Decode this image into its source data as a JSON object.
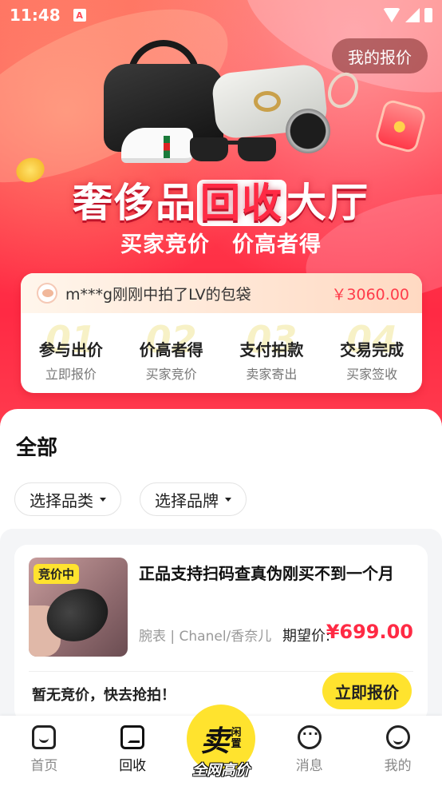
{
  "status_bar": {
    "time": "11:48",
    "notification_badge": "A"
  },
  "header": {
    "my_quotes_label": "我的报价"
  },
  "hero": {
    "title_part1": "奢侈品",
    "title_highlight": "回收",
    "title_part2": "大厅",
    "subtitle": "买家竞价　价高者得"
  },
  "ticker": {
    "text": "m***g刚刚中拍了LV的包袋",
    "price": "￥3060.00"
  },
  "steps": [
    {
      "num": "01",
      "title": "参与出价",
      "sub": "立即报价"
    },
    {
      "num": "02",
      "title": "价高者得",
      "sub": "买家竞价"
    },
    {
      "num": "03",
      "title": "支付拍款",
      "sub": "卖家寄出"
    },
    {
      "num": "04",
      "title": "交易完成",
      "sub": "买家签收"
    }
  ],
  "section": {
    "title": "全部"
  },
  "filters": {
    "category": "选择品类",
    "brand": "选择品牌"
  },
  "items": [
    {
      "badge": "竞价中",
      "title": "正品支持扫码查真伪刚买不到一个月",
      "meta": "腕表 | Chanel/香奈儿",
      "expect_label": "期望价:",
      "expect_price": "¥699.00",
      "status": "暂无竞价，快去抢拍！",
      "action": "立即报价"
    }
  ],
  "tabbar": {
    "home": "首页",
    "recycle": "回收",
    "sell_main": "卖",
    "sell_small_1": "闲",
    "sell_small_2": "置",
    "sell_caption": "全网高价",
    "messages": "消息",
    "me": "我的"
  },
  "colors": {
    "accent_red": "#ff2a44",
    "accent_yellow": "#ffe32e"
  }
}
